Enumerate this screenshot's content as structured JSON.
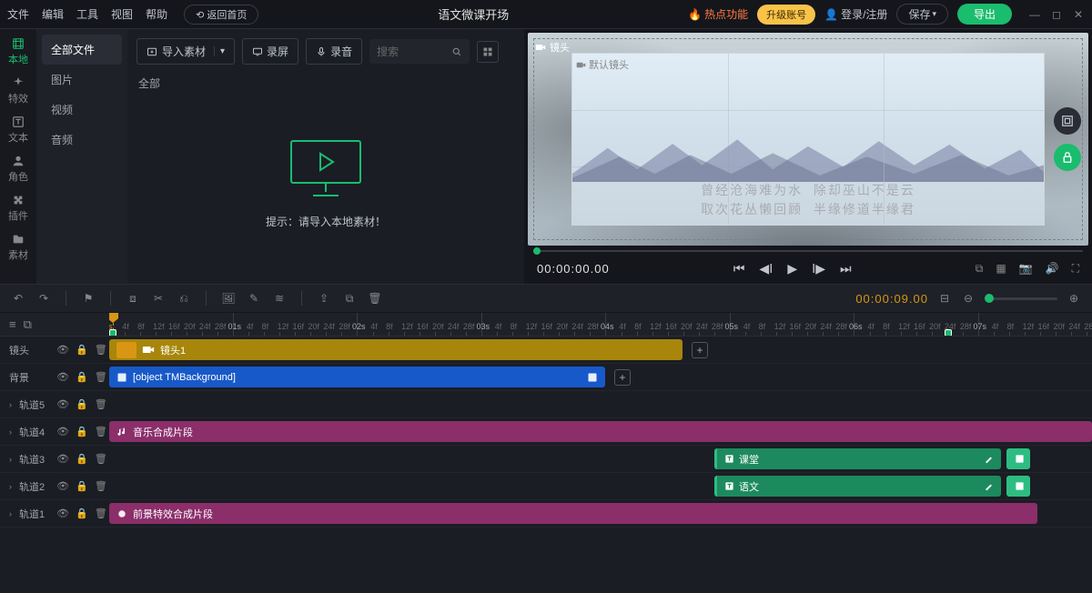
{
  "menu": {
    "file": "文件",
    "edit": "编辑",
    "tool": "工具",
    "view": "视图",
    "help": "帮助"
  },
  "back_home": "返回首页",
  "project_title": "语文微课开场",
  "hot_label": "热点功能",
  "upgrade_label": "升级账号",
  "login_label": "登录/注册",
  "save_label": "保存",
  "export_label": "导出",
  "left_nav": {
    "local": "本地",
    "fx": "特效",
    "text": "文本",
    "role": "角色",
    "plugin": "插件",
    "material": "素材"
  },
  "subcats": {
    "all": "全部文件",
    "image": "图片",
    "video": "视频",
    "audio": "音频"
  },
  "media": {
    "import": "导入素材",
    "record_screen": "录屏",
    "record_audio": "录音",
    "search_placeholder": "搜索",
    "all": "全部",
    "tip": "提示：请导入本地素材！"
  },
  "preview": {
    "camera_tag": "镜头",
    "default_lens": "默认镜头",
    "timecode": "00:00:00.00"
  },
  "toolbar": {
    "duration": "00:00:09.00"
  },
  "ruler": {
    "seconds": [
      "0s",
      "01s",
      "02s",
      "03s",
      "04s",
      "05s",
      "06s",
      "07s"
    ],
    "frames": [
      "4f",
      "8f",
      "12f",
      "16f",
      "20f",
      "24f",
      "28f"
    ]
  },
  "tracks": {
    "lens": {
      "label": "镜头",
      "clip": "镜头1"
    },
    "bg": {
      "label": "背景",
      "clip": "[object TMBackground]"
    },
    "t5": "轨道5",
    "t4": "轨道4",
    "t3": "轨道3",
    "t2": "轨道2",
    "t1": "轨道1",
    "music_clip": "音乐合成片段",
    "text_class": "课堂",
    "text_lang": "语文",
    "fg_fx": "前景特效合成片段"
  }
}
